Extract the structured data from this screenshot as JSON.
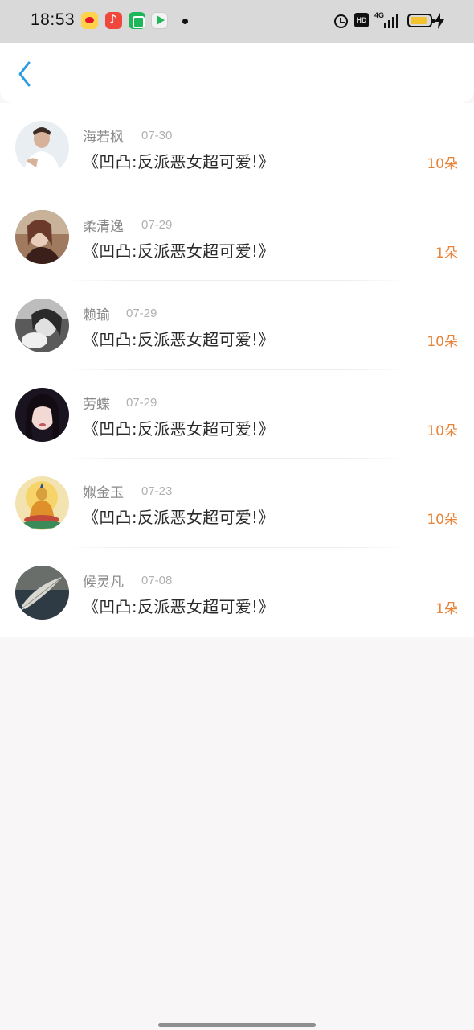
{
  "status_bar": {
    "time": "18:53",
    "network": "4G",
    "hd_label": "HD",
    "icons": [
      "weibo-app-icon",
      "music-app-icon",
      "green-app-icon",
      "video-app-icon",
      "alarm-icon",
      "signal-icon",
      "battery-icon",
      "charging-icon"
    ]
  },
  "header": {
    "back_icon": "chevron-left-icon",
    "accent": "#2a9fe0"
  },
  "colors": {
    "name": "#8a8a8a",
    "date": "#b0b0b0",
    "title": "#2a2a2a",
    "count": "#e8843a"
  },
  "items": [
    {
      "name": "海若枫",
      "date": "07-30",
      "title": "《凹凸:反派恶女超可爱!》",
      "count": "10朵"
    },
    {
      "name": "柔清逸",
      "date": "07-29",
      "title": "《凹凸:反派恶女超可爱!》",
      "count": "1朵"
    },
    {
      "name": "赖瑜",
      "date": "07-29",
      "title": "《凹凸:反派恶女超可爱!》",
      "count": "10朵"
    },
    {
      "name": "劳蝶",
      "date": "07-29",
      "title": "《凹凸:反派恶女超可爱!》",
      "count": "10朵"
    },
    {
      "name": "娰金玉",
      "date": "07-23",
      "title": "《凹凸:反派恶女超可爱!》",
      "count": "10朵"
    },
    {
      "name": "候灵凡",
      "date": "07-08",
      "title": "《凹凸:反派恶女超可爱!》",
      "count": "1朵"
    }
  ]
}
